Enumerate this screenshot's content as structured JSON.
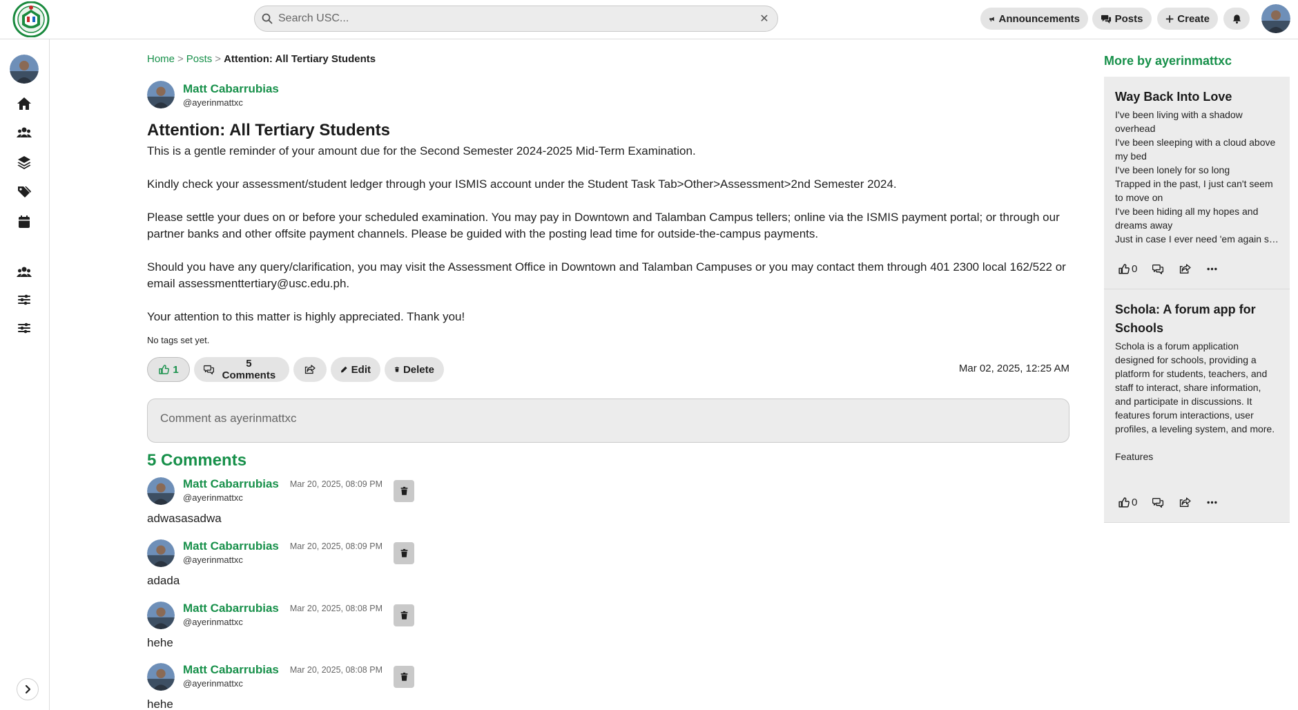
{
  "header": {
    "search_placeholder": "Search USC...",
    "clear_icon": "close-icon",
    "nav": {
      "announcements": "Announcements",
      "posts": "Posts",
      "create": "Create"
    },
    "brand_colors": {
      "accent": "#17904a",
      "pill_bg": "#e4e4e4",
      "field_bg": "#ececec"
    }
  },
  "sidebar": {
    "icons": [
      "home-icon",
      "users-icon",
      "layers-icon",
      "tags-icon",
      "calendar-icon",
      "group-icon",
      "sliders-icon",
      "sliders-icon"
    ],
    "expand_icon": "chevron-right-icon"
  },
  "breadcrumb": {
    "home": "Home",
    "sep1": ">",
    "posts": "Posts",
    "sep2": ">",
    "current": "Attention: All Tertiary Students"
  },
  "post": {
    "author_name": "Matt Cabarrubias",
    "author_handle": "@ayerinmattxc",
    "title": "Attention: All Tertiary Students",
    "paragraphs": [
      "This is a gentle reminder of your amount due for the Second Semester 2024-2025 Mid-Term Examination.",
      "Kindly check your assessment/student ledger through your ISMIS account under the Student Task Tab>Other>Assessment>2nd Semester 2024.",
      "Please settle your dues on or before your scheduled examination. You may pay in Downtown and Talamban Campus tellers; online via the ISMIS payment portal; or through our partner banks and other offsite payment channels. Please be guided with the posting lead time for outside-the-campus payments.",
      "Should you have any query/clarification, you may visit the Assessment Office in Downtown and Talamban Campuses or you may contact them through 401 2300 local 162/522 or email assessmenttertiary@usc.edu.ph.",
      "Your attention to this matter is highly appreciated. Thank you!"
    ],
    "tags_note": "No tags set yet.",
    "likes": "1",
    "comments_label": "5 Comments",
    "edit_label": "Edit",
    "delete_label": "Delete",
    "date": "Mar 02, 2025, 12:25 AM"
  },
  "comment_input": {
    "placeholder": "Comment as ayerinmattxc"
  },
  "comments": {
    "heading": "5 Comments",
    "items": [
      {
        "name": "Matt Cabarrubias",
        "handle": "@ayerinmattxc",
        "date": "Mar 20, 2025, 08:09 PM",
        "text": "adwasasadwa"
      },
      {
        "name": "Matt Cabarrubias",
        "handle": "@ayerinmattxc",
        "date": "Mar 20, 2025, 08:09 PM",
        "text": "adada"
      },
      {
        "name": "Matt Cabarrubias",
        "handle": "@ayerinmattxc",
        "date": "Mar 20, 2025, 08:08 PM",
        "text": "hehe"
      },
      {
        "name": "Matt Cabarrubias",
        "handle": "@ayerinmattxc",
        "date": "Mar 20, 2025, 08:08 PM",
        "text": "hehe"
      }
    ]
  },
  "more_by": {
    "heading": "More by ayerinmattxc",
    "cards": [
      {
        "title": "Way Back Into Love",
        "lines": [
          "I've been living with a shadow overhead",
          "I've been sleeping with a cloud above my bed",
          "I've been lonely for so long",
          "Trapped in the past, I just can't seem to move on",
          "I've been hiding all my hopes and dreams away",
          "Just in case I ever need 'em again someday"
        ],
        "likes": "0"
      },
      {
        "title": "Schola: A forum app for Schools",
        "lines": [
          "Schola is a forum application designed for schools, providing a platform for students, teachers, and staff to interact, share information, and participate in discussions. It features forum interactions, user profiles, a leveling system, and more.",
          "Features"
        ],
        "likes": "0"
      }
    ]
  }
}
